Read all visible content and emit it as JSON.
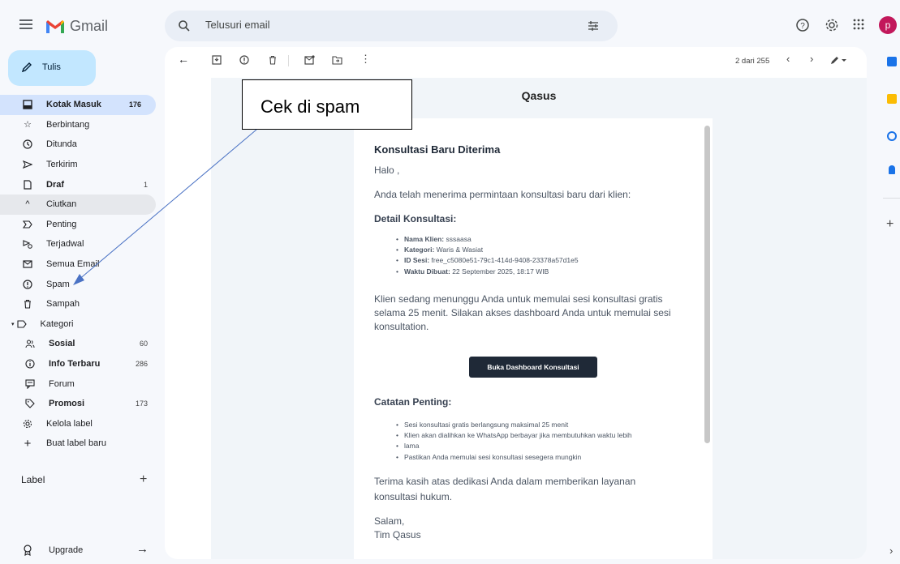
{
  "topbar": {
    "logo_text": "Gmail",
    "search_placeholder": "Telusuri email",
    "avatar_letter": "p"
  },
  "sidebar": {
    "compose_label": "Tulis",
    "items": [
      {
        "label": "Kotak Masuk",
        "count": "176"
      },
      {
        "label": "Berbintang",
        "count": ""
      },
      {
        "label": "Ditunda",
        "count": ""
      },
      {
        "label": "Terkirim",
        "count": ""
      },
      {
        "label": "Draf",
        "count": "1"
      },
      {
        "label": "Ciutkan",
        "count": ""
      },
      {
        "label": "Penting",
        "count": ""
      },
      {
        "label": "Terjadwal",
        "count": ""
      },
      {
        "label": "Semua Email",
        "count": ""
      },
      {
        "label": "Spam",
        "count": ""
      },
      {
        "label": "Sampah",
        "count": ""
      },
      {
        "label": "Kategori",
        "count": ""
      },
      {
        "label": "Sosial",
        "count": "60"
      },
      {
        "label": "Info Terbaru",
        "count": "286"
      },
      {
        "label": "Forum",
        "count": ""
      },
      {
        "label": "Promosi",
        "count": "173"
      },
      {
        "label": "Kelola label",
        "count": ""
      },
      {
        "label": "Buat label baru",
        "count": ""
      }
    ],
    "label_heading": "Label",
    "upgrade_label": "Upgrade"
  },
  "toolbar": {
    "pager_text": "2 dari 255"
  },
  "email": {
    "brand": "Qasus",
    "heading": "Konsultasi Baru Diterima",
    "greeting": "Halo ,",
    "intro": "Anda telah menerima permintaan konsultasi baru dari klien:",
    "detail_heading": "Detail Konsultasi:",
    "details": [
      {
        "key": "Nama Klien:",
        "value": " sssaasa"
      },
      {
        "key": "Kategori:",
        "value": " Waris & Wasiat"
      },
      {
        "key": "ID Sesi:",
        "value": " free_c5080e51-79c1-414d-9408-23378a57d1e5"
      },
      {
        "key": "Waktu Dibuat:",
        "value": " 22 September 2025, 18:17 WIB"
      }
    ],
    "wait_line1": "Klien sedang menunggu Anda untuk memulai sesi konsultasi gratis",
    "wait_line2": "selama 25 menit. Silakan akses dashboard Anda untuk memulai sesi",
    "wait_line3": "konsultation.",
    "cta_label": "Buka Dashboard Konsultasi",
    "notes_heading": "Catatan Penting:",
    "notes": [
      "Sesi konsultasi gratis berlangsung maksimal 25 menit",
      "Klien akan dialihkan ke WhatsApp berbayar jika membutuhkan waktu lebih",
      "lama",
      "Pastikan Anda memulai sesi konsultasi sesegera mungkin"
    ],
    "thanks_line1": "Terima kasih atas dedikasi Anda dalam memberikan layanan",
    "thanks_line2": "konsultasi hukum.",
    "signoff": "Salam,",
    "signature": "Tim Qasus"
  },
  "annotation": {
    "text": "Cek di spam"
  },
  "colors": {
    "accent": "#c2e7ff",
    "active_nav": "#d3e3fd",
    "cta": "#1f2937",
    "avatar": "#c2185b"
  }
}
